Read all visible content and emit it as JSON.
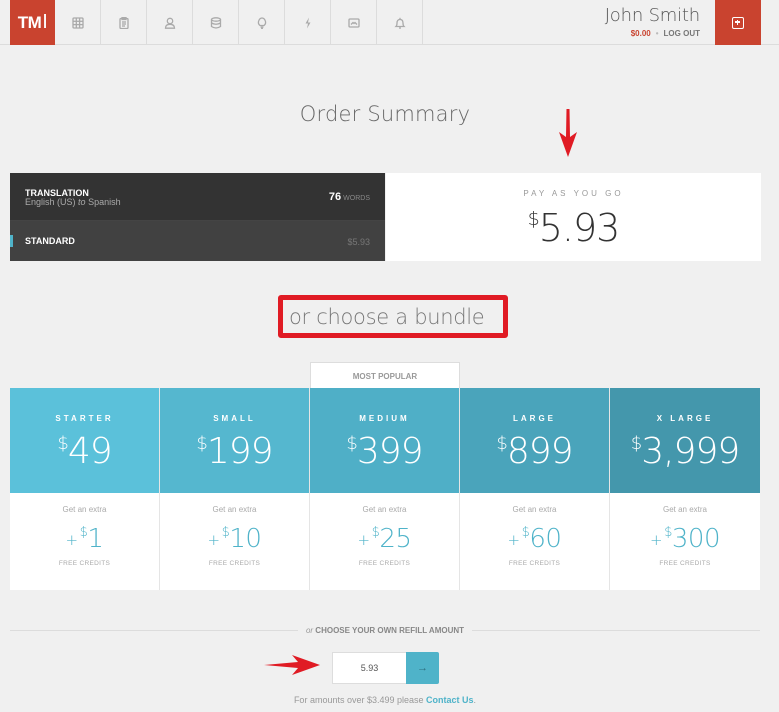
{
  "header": {
    "logo": "TM",
    "logo_cursor": "I",
    "nav_icons": [
      "grid-icon",
      "clipboard-icon",
      "user-icon",
      "database-icon",
      "lightbulb-icon",
      "lightning-icon",
      "mail-icon",
      "bell-icon"
    ],
    "user_name": "John Smith",
    "balance": "$0.00",
    "separator": "•",
    "logout_label": "LOG OUT"
  },
  "page": {
    "title": "Order Summary"
  },
  "summary": {
    "service_label": "TRANSLATION",
    "language_from": "English (US)",
    "language_to_word": "to",
    "language_to": "Spanish",
    "word_count": "76",
    "word_unit": "WORDS",
    "tier_label": "STANDARD",
    "tier_price": "$5.93",
    "payg_label": "PAY AS YOU GO",
    "payg_currency": "$",
    "payg_amount": "5.93"
  },
  "bundles": {
    "heading": "or choose a bundle",
    "most_popular_label": "MOST POPULAR",
    "tiers": [
      {
        "name": "STARTER",
        "currency": "$",
        "price": "49",
        "extra_label": "Get an extra",
        "plus": "+",
        "credit_currency": "$",
        "credit": "1",
        "credit_label": "FREE CREDITS",
        "color": "#5bc1da"
      },
      {
        "name": "SMALL",
        "currency": "$",
        "price": "199",
        "extra_label": "Get an extra",
        "plus": "+",
        "credit_currency": "$",
        "credit": "10",
        "credit_label": "FREE CREDITS",
        "color": "#55b7cf"
      },
      {
        "name": "MEDIUM",
        "currency": "$",
        "price": "399",
        "extra_label": "Get an extra",
        "plus": "+",
        "credit_currency": "$",
        "credit": "25",
        "credit_label": "FREE CREDITS",
        "color": "#4fafc7"
      },
      {
        "name": "LARGE",
        "currency": "$",
        "price": "899",
        "extra_label": "Get an extra",
        "plus": "+",
        "credit_currency": "$",
        "credit": "60",
        "credit_label": "FREE CREDITS",
        "color": "#4aa4bb"
      },
      {
        "name": "X LARGE",
        "currency": "$",
        "price": "3,999",
        "extra_label": "Get an extra",
        "plus": "+",
        "credit_currency": "$",
        "credit": "300",
        "credit_label": "FREE CREDITS",
        "color": "#4497ac"
      }
    ]
  },
  "refill": {
    "or_word": "or",
    "label": "CHOOSE YOUR OWN REFILL AMOUNT",
    "input_value": "5.93",
    "go_icon": "→",
    "note_prefix": "For amounts over $3.499 please",
    "contact_link": "Contact Us",
    "note_suffix": "."
  },
  "annotations": {
    "arrow_color": "#e01b24",
    "highlight_color": "#e01b24"
  }
}
